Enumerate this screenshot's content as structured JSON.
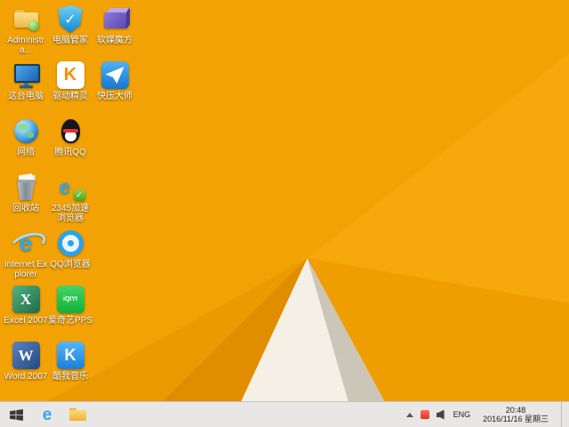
{
  "colors": {
    "wall-base": "#f3a205",
    "wall-upper-right": "#f6a80c",
    "wall-right": "#ef9e02",
    "wall-fold-mid": "#ec9a02",
    "wall-fold-dark": "#e08e00",
    "wall-paper-white": "#f4f0e6",
    "wall-paper-shadow": "#ccc6b8",
    "taskbar-bg": "#e8e7e5",
    "ie-blue": "#2fa8e8"
  },
  "desktop": {
    "icons": [
      {
        "name": "administrator",
        "label": "Administra..."
      },
      {
        "name": "this-pc",
        "label": "这台电脑"
      },
      {
        "name": "network",
        "label": "网络"
      },
      {
        "name": "recycle-bin",
        "label": "回收站"
      },
      {
        "name": "internet-explorer",
        "label": "Internet Explorer",
        "glyph": "e"
      },
      {
        "name": "excel-2007",
        "label": "Excel 2007",
        "glyph": "X"
      },
      {
        "name": "word-2007",
        "label": "Word 2007",
        "glyph": "W"
      },
      {
        "name": "pc-manager",
        "label": "电脑管家",
        "glyph": "✓"
      },
      {
        "name": "driver-genius",
        "label": "驱动精灵",
        "glyph": "K"
      },
      {
        "name": "tencent-qq",
        "label": "腾讯QQ"
      },
      {
        "name": "2345-browser",
        "label": "2345加速浏览器",
        "glyph": "e",
        "badge_glyph": "✓"
      },
      {
        "name": "qq-browser",
        "label": "QQ浏览器"
      },
      {
        "name": "iqiyi-pps",
        "label": "爱奇艺PPS",
        "glyph": "iQIYI"
      },
      {
        "name": "kuwo-music",
        "label": "酷我音乐",
        "glyph": "K"
      },
      {
        "name": "ruanmei-mofang",
        "label": "软媒魔方"
      },
      {
        "name": "kuaizip",
        "label": "快压大师"
      }
    ]
  },
  "taskbar": {
    "pinned": [
      {
        "name": "internet-explorer",
        "glyph": "e"
      },
      {
        "name": "file-explorer"
      }
    ],
    "tray": {
      "language": "ENG",
      "time": "20:48",
      "date": "2016/11/16 星期三"
    }
  }
}
